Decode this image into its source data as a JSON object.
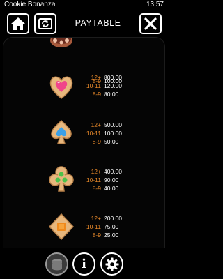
{
  "status": {
    "app_name": "Cookie Bonanza",
    "time": "13:57"
  },
  "header": {
    "title": "PAYTABLE"
  },
  "paytable": {
    "partial_row": {
      "pays": [
        {
          "count": "8-9",
          "value": "100.00"
        }
      ]
    },
    "rows": [
      {
        "symbol": "heart-cookie-icon",
        "jam_color": "#f0458a",
        "pays": [
          {
            "count": "12+",
            "value": "800.00"
          },
          {
            "count": "10-11",
            "value": "120.00"
          },
          {
            "count": "8-9",
            "value": "80.00"
          }
        ]
      },
      {
        "symbol": "spade-cookie-icon",
        "jam_color": "#3aa0e8",
        "pays": [
          {
            "count": "12+",
            "value": "500.00"
          },
          {
            "count": "10-11",
            "value": "100.00"
          },
          {
            "count": "8-9",
            "value": "50.00"
          }
        ]
      },
      {
        "symbol": "club-cookie-icon",
        "jam_color": "#4cc24a",
        "pays": [
          {
            "count": "12+",
            "value": "400.00"
          },
          {
            "count": "10-11",
            "value": "90.00"
          },
          {
            "count": "8-9",
            "value": "40.00"
          }
        ]
      },
      {
        "symbol": "diamond-cookie-icon",
        "jam_color": "#f08a1c",
        "pays": [
          {
            "count": "12+",
            "value": "200.00"
          },
          {
            "count": "10-11",
            "value": "75.00"
          },
          {
            "count": "8-9",
            "value": "25.00"
          }
        ]
      }
    ]
  },
  "colors": {
    "count_orange": "#e8892a",
    "cookie": "#e7b77d",
    "background": "#000000"
  }
}
